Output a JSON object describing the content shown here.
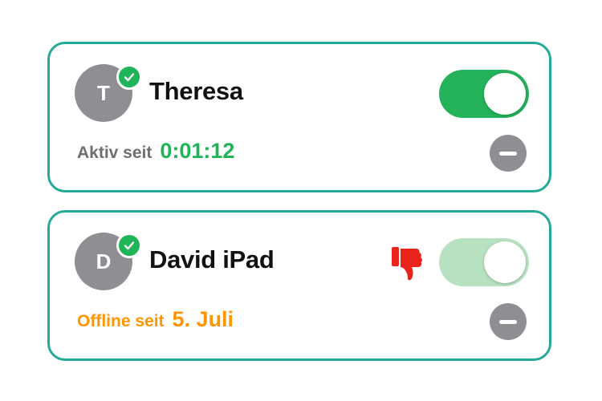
{
  "colors": {
    "card_border": "#27a99a",
    "active_green": "#1fb457",
    "toggle_on": "#23b25a",
    "toggle_dim": "#b6e2c1",
    "offline_orange": "#ff9500",
    "avatar_gray": "#8e8e93",
    "thumb_red": "#e8231a"
  },
  "devices": [
    {
      "avatar_initial": "T",
      "name": "Theresa",
      "verified_icon": "check-circle-icon",
      "toggle_on": true,
      "status_label": "Aktiv seit",
      "status_value": "0:01:12",
      "remove_icon": "minus-circle-icon"
    },
    {
      "avatar_initial": "D",
      "name": "David iPad",
      "verified_icon": "check-circle-icon",
      "warning_icon": "thumbs-down-icon",
      "toggle_on": true,
      "toggle_dimmed": true,
      "status_label": "Offline seit",
      "status_value": "5. Juli",
      "remove_icon": "minus-circle-icon"
    }
  ]
}
